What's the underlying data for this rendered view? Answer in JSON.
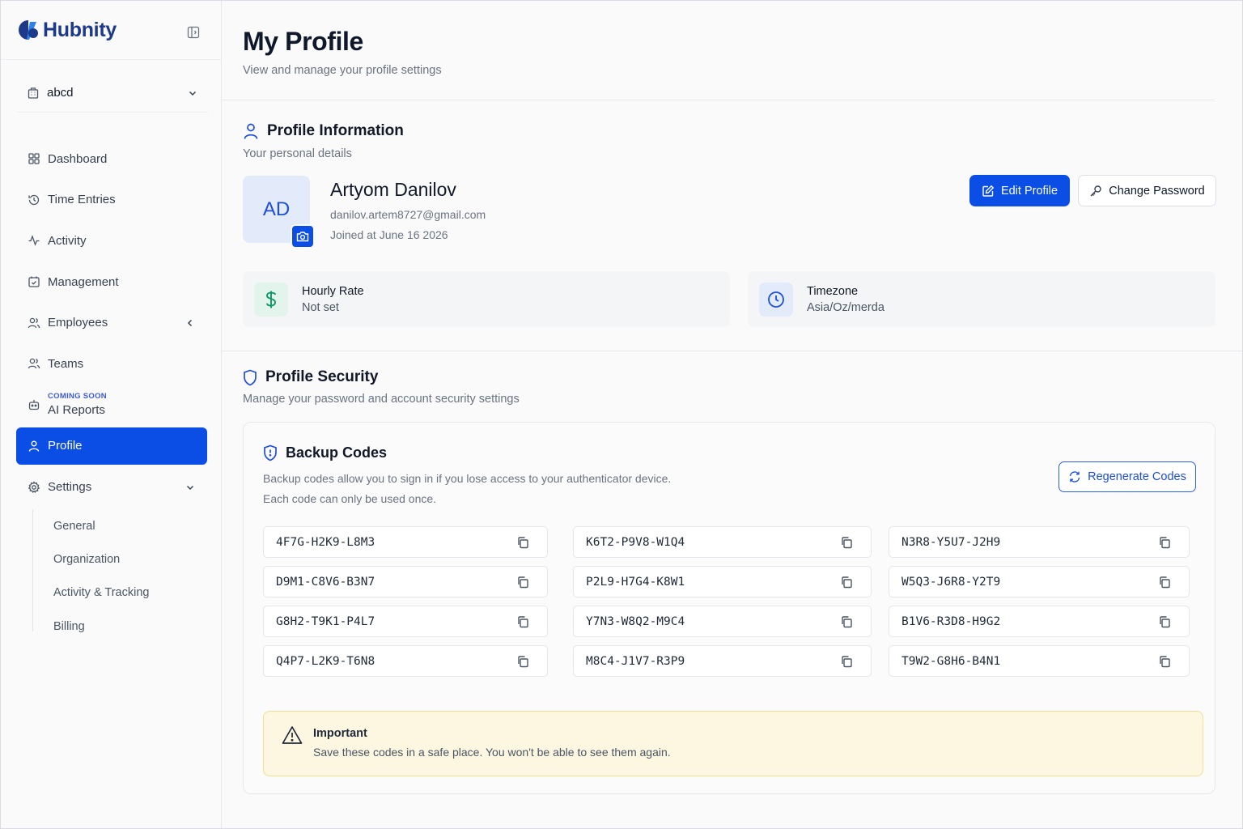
{
  "brand": {
    "name": "Hubnity"
  },
  "workspace": {
    "name": "abcd"
  },
  "sidebar": {
    "items": [
      {
        "label": "Dashboard"
      },
      {
        "label": "Time Entries"
      },
      {
        "label": "Activity"
      },
      {
        "label": "Management"
      },
      {
        "label": "Employees"
      },
      {
        "label": "Teams"
      },
      {
        "label": "AI Reports",
        "badge": "COMING SOON"
      },
      {
        "label": "Profile"
      },
      {
        "label": "Settings"
      }
    ],
    "settings_sub": [
      {
        "label": "General"
      },
      {
        "label": "Organization"
      },
      {
        "label": "Activity & Tracking"
      },
      {
        "label": "Billing"
      }
    ]
  },
  "page": {
    "title": "My Profile",
    "subtitle": "View and manage your profile settings"
  },
  "profile_info": {
    "title": "Profile Information",
    "subtitle": "Your personal details",
    "initials": "AD",
    "name": "Artyom Danilov",
    "email": "danilov.artem8727@gmail.com",
    "joined": "Joined at June 16 2026",
    "edit_label": "Edit Profile",
    "change_password_label": "Change Password",
    "hourly_rate": {
      "label": "Hourly Rate",
      "value": "Not set"
    },
    "timezone": {
      "label": "Timezone",
      "value": "Asia/Oz/merda"
    }
  },
  "security": {
    "title": "Profile Security",
    "subtitle": "Manage your password and account security settings",
    "backup": {
      "title": "Backup Codes",
      "desc1": "Backup codes allow you to sign in if you lose access to your authenticator device.",
      "desc2": "Each code can only be used once.",
      "regen_label": "Regenerate Codes",
      "codes": [
        "4F7G-H2K9-L8M3",
        "K6T2-P9V8-W1Q4",
        "N3R8-Y5U7-J2H9",
        "D9M1-C8V6-B3N7",
        "P2L9-H7G4-K8W1",
        "W5Q3-J6R8-Y2T9",
        "G8H2-T9K1-P4L7",
        "Y7N3-W8Q2-M9C4",
        "B1V6-R3D8-H9G2",
        "Q4P7-L2K9-T6N8",
        "M8C4-J1V7-R3P9",
        "T9W2-G8H6-B4N1"
      ],
      "alert_title": "Important",
      "alert_text": "Save these codes in a safe place. You won't be able to see them again."
    }
  },
  "colors": {
    "primary": "#0b4ee6",
    "brand_dark": "#1d3a8a",
    "dollar_green": "#10956a",
    "warning_bg": "#fdf7e2",
    "warning_border": "#f1dc9a"
  }
}
